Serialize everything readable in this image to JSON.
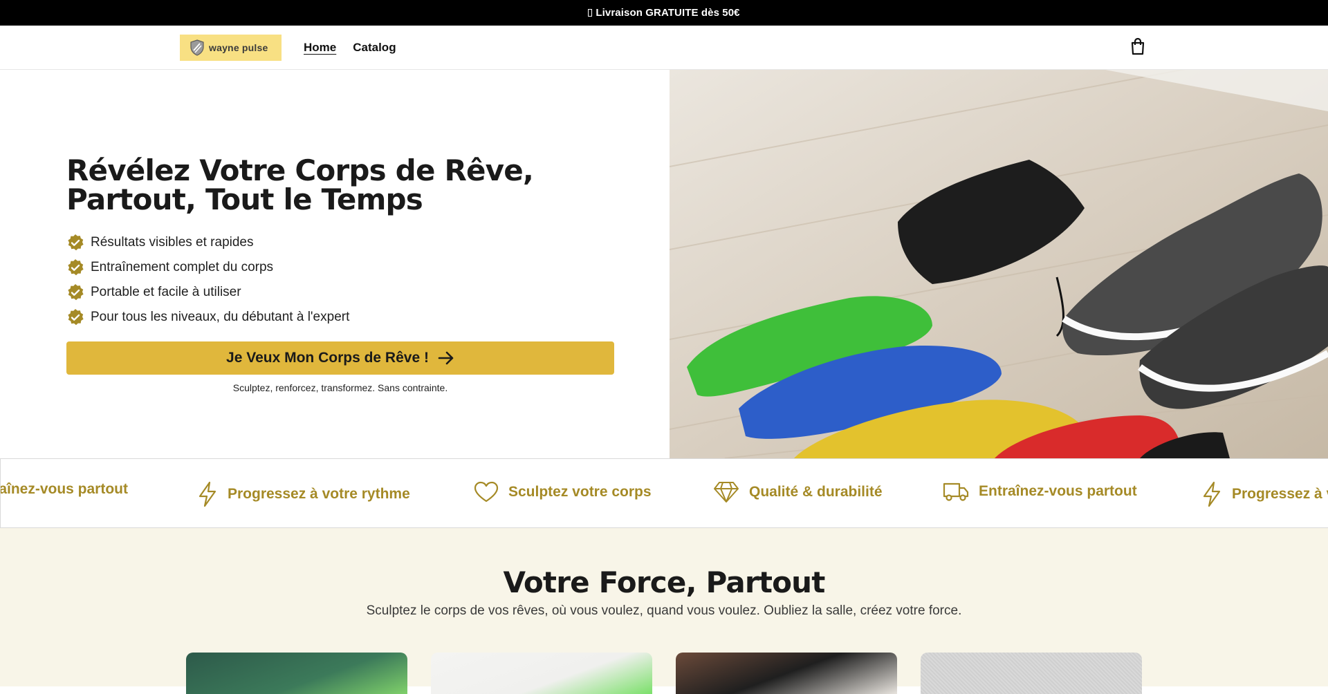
{
  "announcement": {
    "text": "Livraison GRATUITE dès 50€"
  },
  "header": {
    "logo_text": "wayne pulse",
    "nav": [
      {
        "label": "Home",
        "active": true
      },
      {
        "label": "Catalog",
        "active": false
      }
    ],
    "cart_icon": "shopping-bag-icon"
  },
  "hero": {
    "title": "Révélez Votre Corps de Rêve, Partout, Tout le Temps",
    "benefits": [
      "Résultats visibles et rapides",
      "Entraînement complet du corps",
      "Portable et facile à utiliser",
      "Pour tous les niveaux, du débutant à l'expert"
    ],
    "cta_label": "Je Veux Mon Corps de Rêve !",
    "cta_subtext": "Sculptez, renforcez, transformez. Sans contrainte.",
    "image_alt": "Bandes de résistance colorées, sac noir et baskets sur un parquet"
  },
  "marquee": {
    "items": [
      {
        "icon": "truck-icon",
        "label": "Entraînez-vous partout"
      },
      {
        "icon": "lightning-icon",
        "label": "Progressez à votre rythme"
      },
      {
        "icon": "heart-icon",
        "label": "Sculptez votre corps"
      },
      {
        "icon": "diamond-icon",
        "label": "Qualité & durabilité"
      },
      {
        "icon": "truck-icon",
        "label": "Entraînez-vous partout"
      },
      {
        "icon": "lightning-icon",
        "label": "Progressez à votre rythme"
      }
    ]
  },
  "section": {
    "title": "Votre Force, Partout",
    "subtitle": "Sculptez le corps de vos rêves, où vous voulez, quand vous voulez. Oubliez la salle, créez votre force."
  },
  "colors": {
    "accent": "#e0b73c",
    "accent_text": "#a58a26",
    "announcement_bg": "#000000",
    "section_bg": "#f8f5e8",
    "logo_bg": "#f8e083"
  }
}
